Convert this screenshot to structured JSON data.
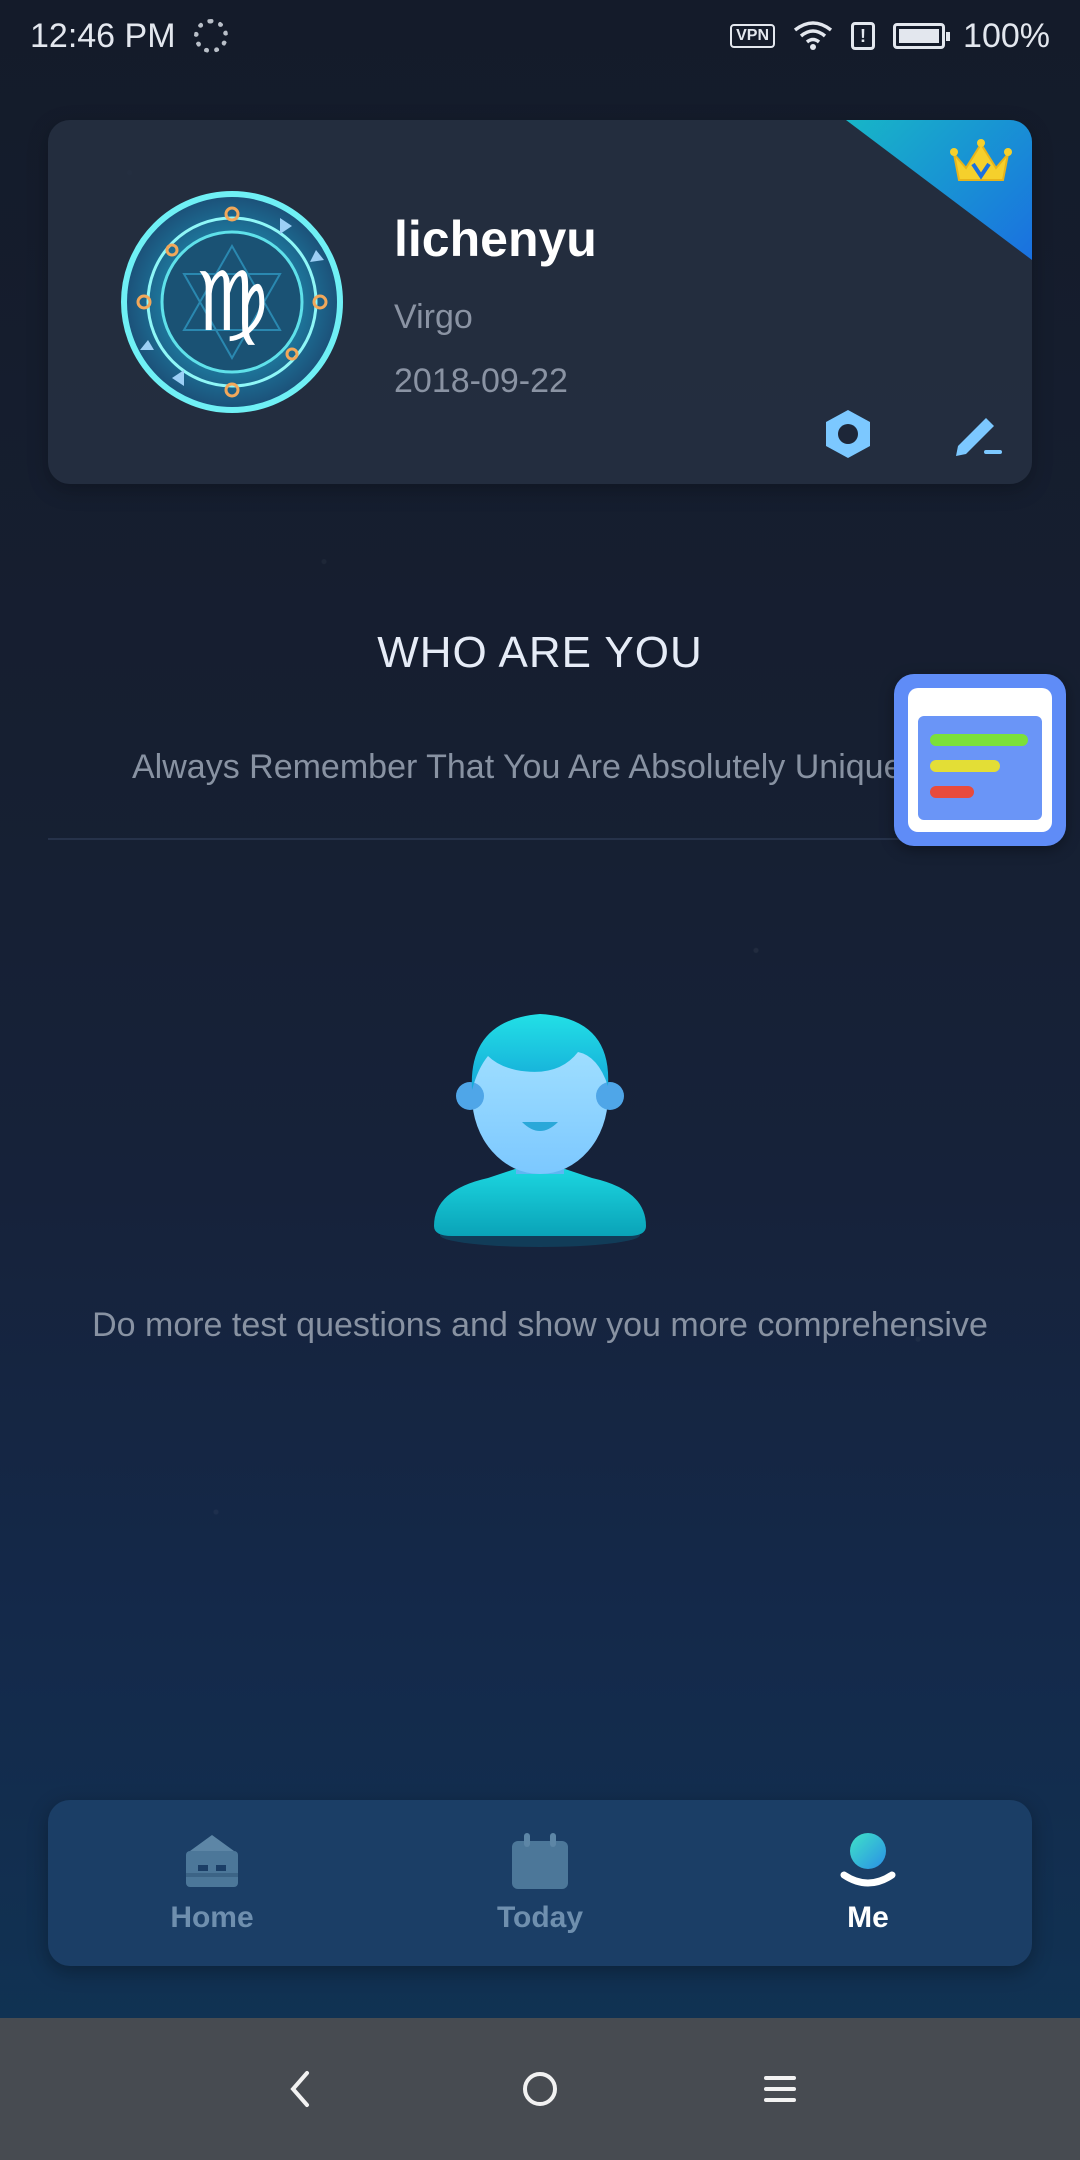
{
  "status_bar": {
    "time": "12:46 PM",
    "vpn_label": "VPN",
    "alert_glyph": "!",
    "battery": "100%"
  },
  "profile": {
    "name": "lichenyu",
    "sign": "Virgo",
    "birth_date": "2018-09-22",
    "avatar_icon": "virgo-zodiac-icon",
    "vip_icon": "crown-icon",
    "accent_color": "#17b6c7"
  },
  "who_are_you": {
    "title": "WHO ARE YOU",
    "subtitle": "Always Remember That You Are Absolutely Unique",
    "hint": "Do more test questions and show you more comprehensive"
  },
  "floating_widget": {
    "icon": "report-card-icon",
    "bar_colors": [
      "#7be03a",
      "#e3de36",
      "#e84b3c"
    ]
  },
  "bottom_nav": {
    "items": [
      {
        "label": "Home",
        "icon": "home-icon",
        "active": false
      },
      {
        "label": "Today",
        "icon": "calendar-icon",
        "active": false
      },
      {
        "label": "Me",
        "icon": "user-icon",
        "active": true
      }
    ]
  },
  "system_nav": {
    "back_icon": "back-icon",
    "home_icon": "home-circle-icon",
    "menu_icon": "menu-icon"
  }
}
